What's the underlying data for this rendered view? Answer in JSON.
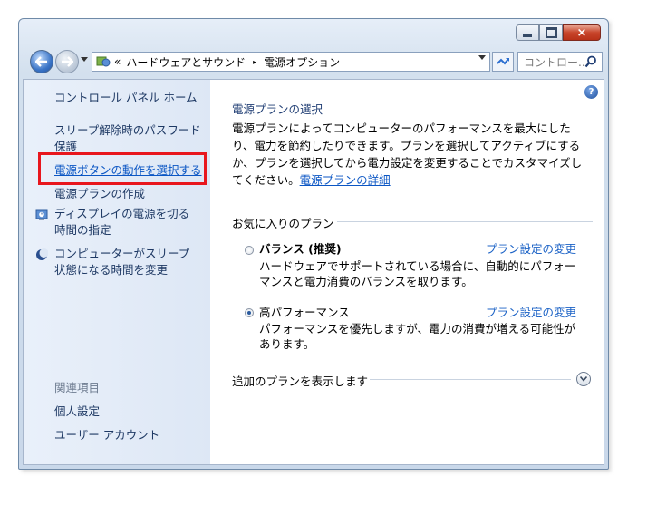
{
  "window": {
    "caption_buttons": {
      "minimize": "minimize-icon",
      "maximize": "maximize-icon",
      "close": "×"
    }
  },
  "address": {
    "prefix": "«",
    "crumb1": "ハードウェアとサウンド",
    "separator": "▸",
    "crumb2": "電源オプション"
  },
  "search": {
    "placeholder": "コントロー..."
  },
  "sidebar": {
    "home": "コントロール パネル ホーム",
    "items": [
      {
        "label": "スリープ解除時のパスワード保護"
      },
      {
        "label": "電源ボタンの動作を選択する"
      },
      {
        "label": "電源プランの作成"
      },
      {
        "label": "ディスプレイの電源を切る時間の指定"
      },
      {
        "label": "コンピューターがスリープ状態になる時間を変更"
      }
    ],
    "related_heading": "関連項目",
    "related": [
      "個人設定",
      "ユーザー アカウント"
    ]
  },
  "main": {
    "title": "電源プランの選択",
    "description": "電源プランによってコンピューターのパフォーマンスを最大にしたり、電力を節約したりできます。プランを選択してアクティブにするか、プランを選択してから電力設定を変更することでカスタマイズしてください。",
    "description_link": "電源プランの詳細",
    "favorites_heading": "お気に入りのプラン",
    "plans": [
      {
        "name": "バランス (推奨)",
        "change_label": "プラン設定の変更",
        "description": "ハードウェアでサポートされている場合に、自動的にパフォーマンスと電力消費のバランスを取ります。",
        "selected": false
      },
      {
        "name": "高パフォーマンス",
        "change_label": "プラン設定の変更",
        "description": "パフォーマンスを優先しますが、電力の消費が増える可能性があります。",
        "selected": true
      }
    ],
    "show_more": "追加のプランを表示します",
    "help": "?"
  },
  "colors": {
    "highlight_border": "#e8161d",
    "link": "#0b56c4",
    "sidebar_bg": "#e9f0fa"
  }
}
